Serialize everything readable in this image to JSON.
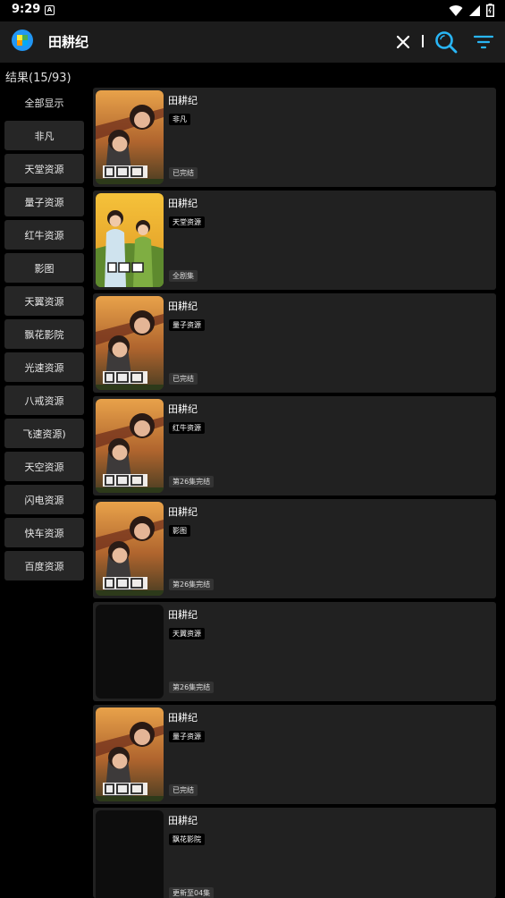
{
  "status_bar": {
    "time": "9:29",
    "notification_glyph": "A"
  },
  "header": {
    "query": "田耕纪"
  },
  "result_count": "结果(15/93)",
  "sidebar": {
    "items": [
      {
        "label": "全部显示"
      },
      {
        "label": "非凡"
      },
      {
        "label": "天堂资源"
      },
      {
        "label": "量子资源"
      },
      {
        "label": "红牛资源"
      },
      {
        "label": "影图"
      },
      {
        "label": "天翼资源"
      },
      {
        "label": "飘花影院"
      },
      {
        "label": "光速资源"
      },
      {
        "label": "八戒资源"
      },
      {
        "label": "飞速资源)"
      },
      {
        "label": "天空资源"
      },
      {
        "label": "闪电资源"
      },
      {
        "label": "快车资源"
      },
      {
        "label": "百度资源"
      }
    ]
  },
  "results": [
    {
      "title": "田耕纪",
      "source": "非凡",
      "status": "已完结",
      "poster": "drama-poster-a"
    },
    {
      "title": "田耕纪",
      "source": "天堂资源",
      "status": "全剧集",
      "poster": "drama-poster-b"
    },
    {
      "title": "田耕纪",
      "source": "量子资源",
      "status": "已完结",
      "poster": "drama-poster-a"
    },
    {
      "title": "田耕纪",
      "source": "红牛资源",
      "status": "第26集完结",
      "poster": "drama-poster-a"
    },
    {
      "title": "田耕纪",
      "source": "影图",
      "status": "第26集完结",
      "poster": "drama-poster-a"
    },
    {
      "title": "田耕纪",
      "source": "天翼资源",
      "status": "第26集完结",
      "poster": "blank"
    },
    {
      "title": "田耕纪",
      "source": "量子资源",
      "status": "已完结",
      "poster": "drama-poster-a"
    },
    {
      "title": "田耕纪",
      "source": "飘花影院",
      "status": "更新至04集",
      "poster": "blank"
    }
  ],
  "colors": {
    "accent": "#29b6f6",
    "card_bg": "#212121",
    "appbar_bg": "#1c1c1c"
  }
}
